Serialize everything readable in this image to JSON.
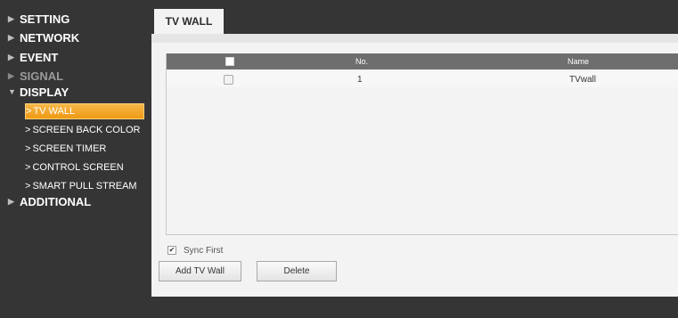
{
  "sidebar": {
    "items": [
      {
        "label": "SETTING",
        "icon": "triangle-right-icon"
      },
      {
        "label": "NETWORK",
        "icon": "triangle-right-icon"
      },
      {
        "label": "EVENT",
        "icon": "triangle-right-icon"
      },
      {
        "label": "SIGNAL",
        "icon": "triangle-right-icon"
      },
      {
        "label": "DISPLAY",
        "icon": "triangle-down-icon"
      },
      {
        "label": "ADDITIONAL",
        "icon": "triangle-right-icon"
      }
    ],
    "display_sub": [
      {
        "label": "TV WALL"
      },
      {
        "label": "SCREEN BACK COLOR"
      },
      {
        "label": "SCREEN TIMER"
      },
      {
        "label": "CONTROL SCREEN"
      },
      {
        "label": "SMART PULL STREAM"
      }
    ]
  },
  "tab": {
    "label": "TV WALL"
  },
  "table": {
    "headers": {
      "no": "No.",
      "name": "Name"
    },
    "rows": [
      {
        "no": "1",
        "name": "TVwall"
      }
    ]
  },
  "sync_first": {
    "label": "Sync First",
    "checked": true
  },
  "buttons": {
    "add": "Add TV Wall",
    "delete": "Delete"
  },
  "colors": {
    "accent": "#f0a020",
    "background": "#353535",
    "panel": "#f3f3f3",
    "table_header": "#6e6e6e"
  }
}
